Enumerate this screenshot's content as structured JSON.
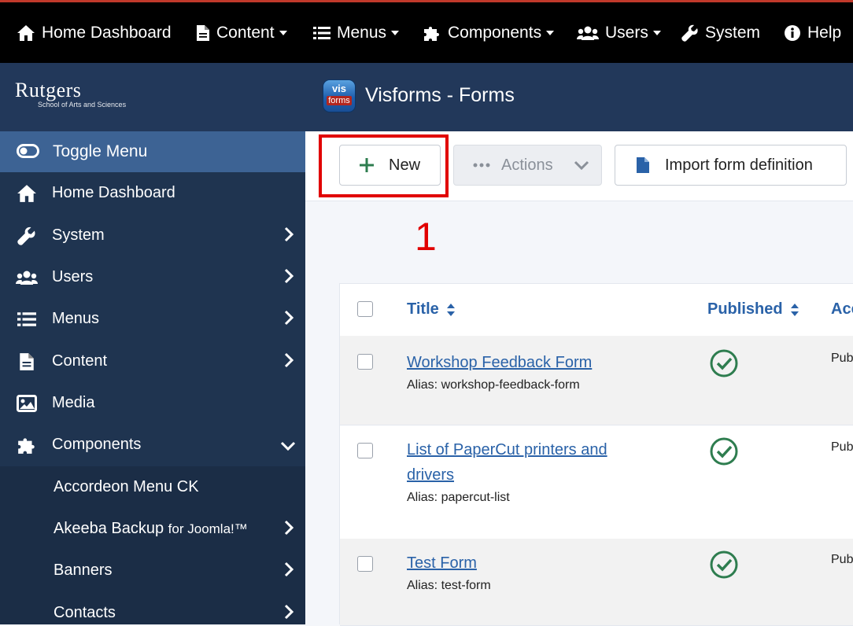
{
  "topnav": {
    "home": "Home Dashboard",
    "content": "Content",
    "menus": "Menus",
    "components": "Components",
    "users": "Users",
    "system": "System",
    "help": "Help"
  },
  "brand": {
    "name": "Rutgers",
    "subtitle": "School of Arts and Sciences"
  },
  "sidebar": {
    "toggle": "Toggle Menu",
    "items": [
      "Home Dashboard",
      "System",
      "Users",
      "Menus",
      "Content",
      "Media",
      "Components"
    ],
    "subitems": [
      {
        "label": "Accordeon Menu CK",
        "suffix": ""
      },
      {
        "label": "Akeeba Backup",
        "suffix": "for Joomla!™"
      },
      {
        "label": "Banners",
        "suffix": ""
      },
      {
        "label": "Contacts",
        "suffix": ""
      }
    ]
  },
  "header": {
    "icon_top": "vis",
    "icon_bottom": "forms",
    "title": "Visforms - Forms"
  },
  "toolbar": {
    "new": "New",
    "actions": "Actions",
    "import": "Import form definition"
  },
  "annotation": "1",
  "table": {
    "headers": {
      "title": "Title",
      "published": "Published",
      "access": "Acc"
    },
    "rows": [
      {
        "title": "Workshop Feedback Form",
        "alias": "Alias: workshop-feedback-form",
        "published": true,
        "access": "Pub"
      },
      {
        "title": "List of PaperCut printers and drivers",
        "alias": "Alias: papercut-list",
        "published": true,
        "access": "Pub"
      },
      {
        "title": "Test Form",
        "alias": "Alias: test-form",
        "published": true,
        "access": "Pub"
      }
    ]
  },
  "colors": {
    "sidebar": "#1f3450",
    "toggle": "#3d6394",
    "link": "#2a62a8",
    "success": "#2e7d4f",
    "annotation": "#e10000"
  }
}
